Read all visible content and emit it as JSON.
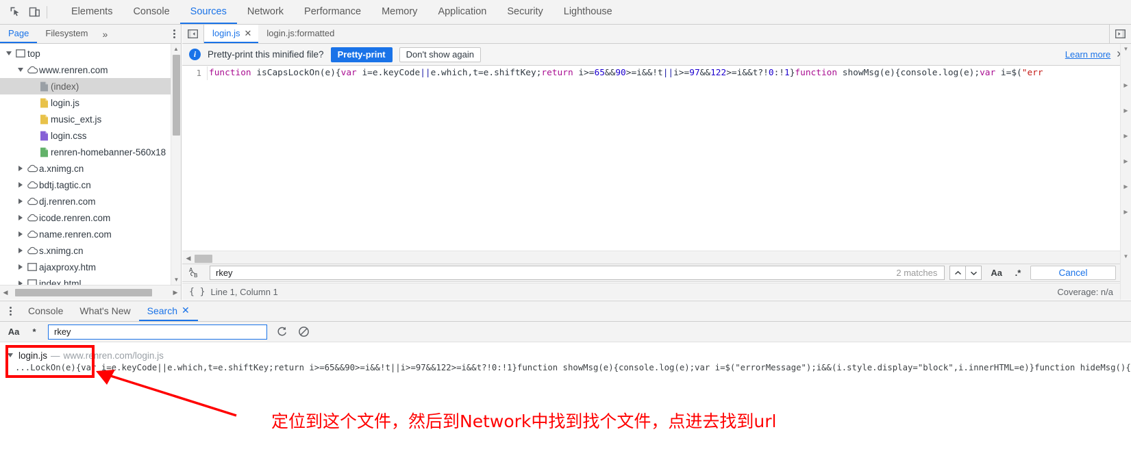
{
  "toolbar": {
    "icons": [
      {
        "name": "inspect-element-icon",
        "glyph": "inspect"
      },
      {
        "name": "device-toolbar-icon",
        "glyph": "device"
      }
    ],
    "tabs": [
      {
        "label": "Elements",
        "active": false
      },
      {
        "label": "Console",
        "active": false
      },
      {
        "label": "Sources",
        "active": true
      },
      {
        "label": "Network",
        "active": false
      },
      {
        "label": "Performance",
        "active": false
      },
      {
        "label": "Memory",
        "active": false
      },
      {
        "label": "Application",
        "active": false
      },
      {
        "label": "Security",
        "active": false
      },
      {
        "label": "Lighthouse",
        "active": false
      }
    ]
  },
  "navigator": {
    "tabs": [
      {
        "label": "Page",
        "active": true
      },
      {
        "label": "Filesystem",
        "active": false
      }
    ],
    "more_label": "»",
    "menu_icon": "more-options-icon",
    "tree": [
      {
        "label": "top",
        "icon": "frame-icon",
        "indent": 0,
        "twisty": "down",
        "selected": false
      },
      {
        "label": "www.renren.com",
        "icon": "cloud-icon",
        "indent": 1,
        "twisty": "down",
        "selected": false
      },
      {
        "label": "(index)",
        "icon": "document-icon",
        "indent": 2,
        "twisty": "none",
        "selected": true
      },
      {
        "label": "login.js",
        "icon": "js-icon",
        "indent": 2,
        "twisty": "none",
        "selected": false
      },
      {
        "label": "music_ext.js",
        "icon": "js-icon",
        "indent": 2,
        "twisty": "none",
        "selected": false
      },
      {
        "label": "login.css",
        "icon": "css-icon",
        "indent": 2,
        "twisty": "none",
        "selected": false
      },
      {
        "label": "renren-homebanner-560x18",
        "icon": "image-icon",
        "indent": 2,
        "twisty": "none",
        "selected": false
      },
      {
        "label": "a.xnimg.cn",
        "icon": "cloud-icon",
        "indent": 1,
        "twisty": "right",
        "selected": false
      },
      {
        "label": "bdtj.tagtic.cn",
        "icon": "cloud-icon",
        "indent": 1,
        "twisty": "right",
        "selected": false
      },
      {
        "label": "dj.renren.com",
        "icon": "cloud-icon",
        "indent": 1,
        "twisty": "right",
        "selected": false
      },
      {
        "label": "icode.renren.com",
        "icon": "cloud-icon",
        "indent": 1,
        "twisty": "right",
        "selected": false
      },
      {
        "label": "name.renren.com",
        "icon": "cloud-icon",
        "indent": 1,
        "twisty": "right",
        "selected": false
      },
      {
        "label": "s.xnimg.cn",
        "icon": "cloud-icon",
        "indent": 1,
        "twisty": "right",
        "selected": false
      },
      {
        "label": "ajaxproxy.htm",
        "icon": "frame-icon",
        "indent": 1,
        "twisty": "right",
        "selected": false
      },
      {
        "label": "index.html",
        "icon": "frame-icon",
        "indent": 1,
        "twisty": "right",
        "selected": false
      }
    ]
  },
  "editor": {
    "sidebar_toggle_icon": "show-navigator-icon",
    "right_toggle_icon": "show-drawer-icon",
    "tabs": [
      {
        "label": "login.js",
        "active": true,
        "closable": true
      },
      {
        "label": "login.js:formatted",
        "active": false,
        "closable": false
      }
    ],
    "infobar": {
      "icon": "info-icon",
      "message": "Pretty-print this minified file?",
      "primary_button": "Pretty-print",
      "secondary_button": "Don't show again",
      "learn_more": "Learn more",
      "close_icon": "close-icon"
    },
    "line_number": "1",
    "code_tokens": [
      {
        "t": "function",
        "c": "k"
      },
      {
        "t": " isCapsLockOn(e){",
        "c": "p"
      },
      {
        "t": "var",
        "c": "k"
      },
      {
        "t": " i=e.keyCode",
        "c": "p"
      },
      {
        "t": "||",
        "c": "v"
      },
      {
        "t": "e.which,t=e.shiftKey;",
        "c": "p"
      },
      {
        "t": "return",
        "c": "k"
      },
      {
        "t": " i>=",
        "c": "p"
      },
      {
        "t": "65",
        "c": "n"
      },
      {
        "t": "&&",
        "c": "p"
      },
      {
        "t": "90",
        "c": "n"
      },
      {
        "t": ">=i&&!t",
        "c": "p"
      },
      {
        "t": "||",
        "c": "v"
      },
      {
        "t": "i>=",
        "c": "p"
      },
      {
        "t": "97",
        "c": "n"
      },
      {
        "t": "&&",
        "c": "p"
      },
      {
        "t": "122",
        "c": "n"
      },
      {
        "t": ">=i&&t?!",
        "c": "p"
      },
      {
        "t": "0",
        "c": "n"
      },
      {
        "t": ":!",
        "c": "p"
      },
      {
        "t": "1",
        "c": "n"
      },
      {
        "t": "}",
        "c": "p"
      },
      {
        "t": "function",
        "c": "k"
      },
      {
        "t": " showMsg(e){console.log(e);",
        "c": "p"
      },
      {
        "t": "var",
        "c": "k"
      },
      {
        "t": " i=$(",
        "c": "p"
      },
      {
        "t": "\"err",
        "c": "s"
      }
    ],
    "find": {
      "icon": "match-case-ab-icon",
      "value": "rkey",
      "placeholder": "Find",
      "match_count": "2 matches",
      "prev_icon": "chevron-up-icon",
      "next_icon": "chevron-down-icon",
      "match_case_label": "Aa",
      "regex_label": ".*",
      "cancel_label": "Cancel"
    },
    "status": {
      "format_icon": "pretty-print-braces-icon",
      "position": "Line 1, Column 1",
      "coverage": "Coverage: n/a"
    }
  },
  "drawer": {
    "menu_icon": "more-options-icon",
    "tabs": [
      {
        "label": "Console",
        "active": false,
        "closable": false
      },
      {
        "label": "What's New",
        "active": false,
        "closable": false
      },
      {
        "label": "Search",
        "active": true,
        "closable": true
      }
    ],
    "search": {
      "match_case_label": "Aa",
      "regex_label": "*",
      "value": "rkey",
      "placeholder": "",
      "refresh_icon": "refresh-icon",
      "clear_icon": "clear-icon"
    },
    "results": [
      {
        "twisty": "down",
        "file": "login.js",
        "dash": "—",
        "url": "www.renren.com/login.js",
        "snippet": "...LockOn(e){var i=e.keyCode||e.which,t=e.shiftKey;return i>=65&&90>=i&&!t||i>=97&&122>=i&&t?!0:!1}function showMsg(e){console.log(e);var i=$(\"errorMessage\");i&&(i.style.display=\"block\",i.innerHTML=e)}function hideMsg(){$(\"errorMessag"
      }
    ]
  },
  "annotation": {
    "text": "定位到这个文件，然后到Network中找到找个文件，点进去找到url",
    "color": "#ff0000",
    "highlight_box": "login-js-result-highlight",
    "arrow": "annotation-arrow"
  }
}
